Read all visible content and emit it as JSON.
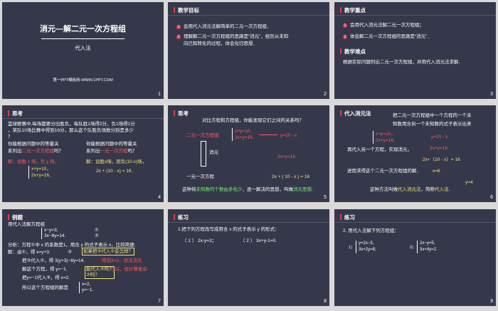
{
  "s1": {
    "title": "消元—解二元一次方程组",
    "subtitle": "代入法",
    "footer": "第一PPT模板网-WWW.1PPT.COM",
    "num": "1"
  },
  "s2": {
    "header": "教学目标",
    "items": [
      "会用代入消元法解简单的二元一次方程组．",
      "理解解二元一次方程组的思路是“消元”，经历从未知",
      "向已知转化的过程，体会化归思想．"
    ],
    "n1": "1",
    "n2": "2",
    "num": "2"
  },
  "s3": {
    "header1": "教学重点",
    "item1": "会用代入消元法解二元一次方程组；",
    "item2": "体会解二元一次方程组的思路是“消元”．",
    "n1": "1",
    "n2": "2",
    "header2": "教学难点",
    "diff": "根据实际问题列出二元一次方程组，并用代入消元法求解.",
    "num": "3"
  },
  "s4": {
    "header": "思考",
    "p1": "篮球联赛中,每场都要分出胜负，每队胜1场得2分，负1场得1分",
    "p2": "，某队10场比赛中得到16分，那么这个队胜负场数分别是多少",
    "p3": "？",
    "l1": "你能根据问题中的等量关",
    "l2a": "系列出",
    "l2b": "二元一次方程组",
    "l2c": "吗？",
    "l3a": "解：设胜 x 场，负 y 场，",
    "eq1": "x+y=10，",
    "eq2": "2x+y=16．",
    "r1": "你能根据问题中的等量关",
    "r2a": "系列出",
    "r2b": "一元一次方程",
    "r2c": "吗？",
    "r3": "解：设胜x场，则负(10-x)场，",
    "r4": "2x + (10 - x) = 16．",
    "num": "4"
  },
  "s5": {
    "header": "思考",
    "q": "对比方程和方程组，你能发现它们之间的关系吗？",
    "a": "二元一次方程组",
    "eq1": "x+y=10，",
    "eq2": "2x+y=16．",
    "y": "y=10 - x",
    "xiao": "消元",
    "eq3": "2x+y=16",
    "b": "一元一次方程",
    "eq4": "2x + ( 10 - x ) = 16",
    "c1": "这种将",
    "c2": "未知数的个数由多化少",
    "c3": "、逐一解决的思想，叫做",
    "c4": "消元思想",
    "c5": ".",
    "num": "5"
  },
  "s6": {
    "header": "代入消元法",
    "d1": "把二元一次方程组中一个方程的一个未",
    "d2": "知数用含另一个未知数的式子表示出来",
    "eq1": "x+y=10，",
    "eq2": "2x+y=16．",
    "y": "y=10 - x",
    "sub": "再代入另一个方程，实现消元，",
    "eq3": "2x+y=16",
    "eq4": "2x+（10 - x）= 16",
    "solve": "进而求得这个二元一次方程组的解．",
    "x": "x=6",
    "yy": "y=4",
    "c1": "这种方法叫做",
    "c2": "代入消元法",
    "c3": "，简称",
    "c4": "代入法",
    "c5": ".",
    "num": "6"
  },
  "s7": {
    "header": "例题",
    "t": "用代入法解方程组",
    "eq1": "x−y=3,",
    "eq2": "3x−8y=14.",
    "m1": "①",
    "m2": "②",
    "a1": "分析：方程①中 x 的系数是1，用含 y 的式子表示 x，比较简便.",
    "a2": "解：由①，得   x=y+3.",
    "m3": "③",
    "b1": "如果把③代入①会怎样？",
    "a3": "把③代入②，得   3(y+3)−8y=14.",
    "b2": "得到3=3，没法消元",
    "a4": "解这个方程，得    y=−1.",
    "b3": "能代入③吗？",
    "b3b": "可以，但计算复杂",
    "a5": "把y=−1代入③，得    x=2.",
    "b4": "②吗？",
    "a6": "所以这个方程组的解是",
    "s1": "x=2,",
    "s2": "y=−1.",
    "num": "7"
  },
  "s8": {
    "header": "练习",
    "t": "1.把下列方程改写成用含 x 的式子表示 y 的形式：",
    "e1": "（ 1 ） 2x-y=3；",
    "e2": "（ 2 ） 3x+y-1=0.",
    "num": "8"
  },
  "s9": {
    "header": "练习",
    "t": "2. 用代入法解下列方程组：",
    "l1": "1)",
    "a1": "y=2x−3,",
    "a2": "3x+2y=8;",
    "l2": "2)",
    "b1": "2x−y=5,",
    "b2": "3x+4y=2.",
    "num": "9"
  }
}
